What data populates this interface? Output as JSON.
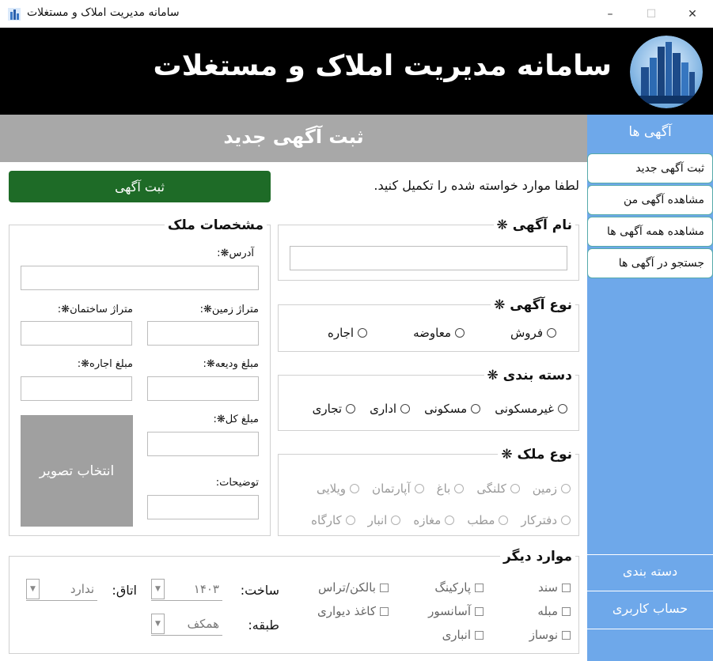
{
  "window": {
    "title": "سامانه مدیریت املاک و مستغلات",
    "controls": {
      "minimize": "–",
      "maximize": "☐",
      "close": "✕"
    }
  },
  "header": {
    "title": "سامانه مدیریت املاک و مستغلات",
    "logo": "city-skyline-logo"
  },
  "section": {
    "title": "ثبت آگهی جدید"
  },
  "form": {
    "instruction": "لطفا موارد خواسته شده را تکمیل کنید.",
    "submit_label": "ثبت آگهی",
    "ad_name": {
      "label": "نام آگهی ❋",
      "value": ""
    },
    "ad_type": {
      "label": "نوع آگهی ❋",
      "options": [
        "فروش",
        "معاوضه",
        "اجاره"
      ]
    },
    "category": {
      "label": "دسته بندی ❋",
      "options": [
        "غیرمسکونی",
        "مسکونی",
        "اداری",
        "تجاری"
      ]
    },
    "property_type": {
      "label": "نوع ملک ❋",
      "row1": [
        "زمین",
        "کلنگی",
        "باغ",
        "آپارتمان",
        "ویلایی"
      ],
      "row2": [
        "دفترکار",
        "مطب",
        "مغازه",
        "انبار",
        "کارگاه"
      ]
    },
    "specs": {
      "title": "مشخصات ملک",
      "address": "آدرس❋:",
      "land_area": "متراژ زمین❋:",
      "building_area": "متراژ ساختمان❋:",
      "deposit": "مبلغ ودیعه❋:",
      "rent": "مبلغ اجاره❋:",
      "total_price": "مبلغ کل❋:",
      "description": "توضیحات:",
      "image_button": "انتخاب تصویر"
    },
    "other": {
      "title": "موارد دیگر",
      "checks": {
        "deed": "سند",
        "parking": "پارکینگ",
        "balcony": "بالکن/تراس",
        "furniture": "مبله",
        "elevator": "آسانسور",
        "wallpaper": "کاغذ دیواری",
        "renovated": "نوساز",
        "storage": "انباری"
      },
      "built_label": "ساخت:",
      "built_value": "۱۴۰۳",
      "rooms_label": "اتاق:",
      "rooms_value": "ندارد",
      "floor_label": "طبقه:",
      "floor_value": "همکف"
    }
  },
  "sidebar": {
    "heading": "آگهی ها",
    "items": [
      {
        "label": "ثبت آگهی جدید"
      },
      {
        "label": "مشاهده آگهی من"
      },
      {
        "label": "مشاهده همه آگهی ها"
      },
      {
        "label": "جستجو در آگهی ها"
      }
    ],
    "bottom": [
      {
        "label": "دسته بندی"
      },
      {
        "label": "حساب کاربری"
      }
    ]
  },
  "colors": {
    "header_bg": "#000000",
    "sidebar_bg": "#6ea8ea",
    "section_bar": "#a8a8a8",
    "submit_green": "#1e6b27"
  }
}
